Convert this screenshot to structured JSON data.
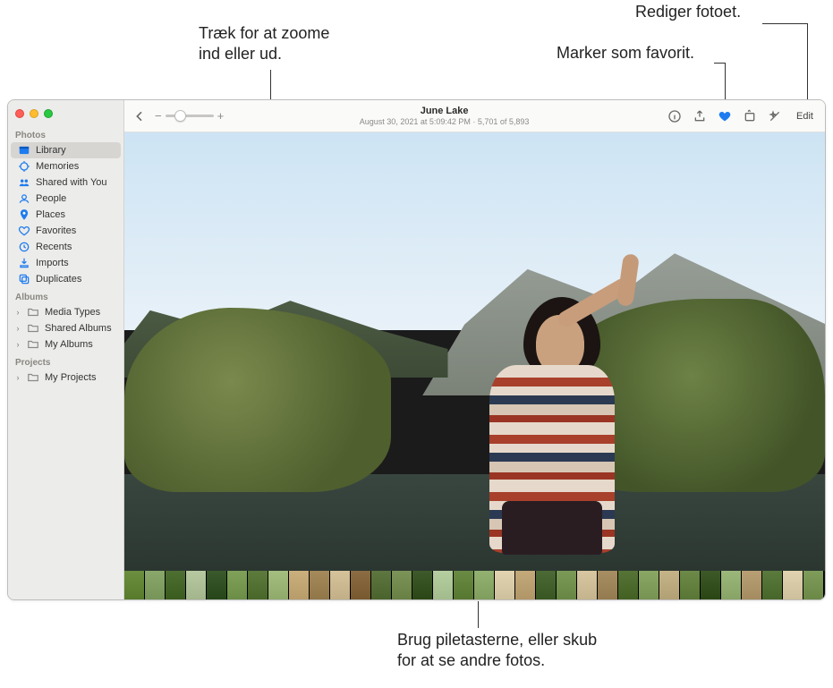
{
  "callouts": {
    "zoom": "Træk for at zoome\nind eller ud.",
    "favorite": "Marker som favorit.",
    "edit": "Rediger fotoet.",
    "arrows": "Brug piletasterne, eller skub\nfor at se andre fotos."
  },
  "sidebar": {
    "sections": {
      "photos": "Photos",
      "albums": "Albums",
      "projects": "Projects"
    },
    "items": {
      "library": "Library",
      "memories": "Memories",
      "shared": "Shared with You",
      "people": "People",
      "places": "Places",
      "favorites": "Favorites",
      "recents": "Recents",
      "imports": "Imports",
      "duplicates": "Duplicates",
      "mediaTypes": "Media Types",
      "sharedAlbums": "Shared Albums",
      "myAlbums": "My Albums",
      "myProjects": "My Projects"
    }
  },
  "toolbar": {
    "title": "June Lake",
    "subtitle": "August 30, 2021 at 5:09:42 PM  ·  5,701 of 5,893",
    "edit": "Edit"
  },
  "colors": {
    "favorite": "#1e7cf0"
  },
  "thumbs": [
    "#6b8e3f",
    "#8aa86b",
    "#4e6f32",
    "#b7c9a0",
    "#3a5a2d",
    "#7fa159",
    "#5d7b3c",
    "#a3be7e",
    "#cbb07d",
    "#a58a5c",
    "#d6c39b",
    "#8b6c43",
    "#5e7740",
    "#7c9458",
    "#3f5a2a",
    "#b6cfa1",
    "#6a8b44",
    "#93b171",
    "#e2d4b0",
    "#c4a97a",
    "#4c6a36",
    "#7b9a57",
    "#d8c7a1",
    "#a88e63",
    "#577437",
    "#8aa766",
    "#c6b489",
    "#6d8a49",
    "#3d5928",
    "#9cb77a",
    "#b89f74",
    "#5b7a3d",
    "#e1d3af",
    "#7f9c5a"
  ]
}
